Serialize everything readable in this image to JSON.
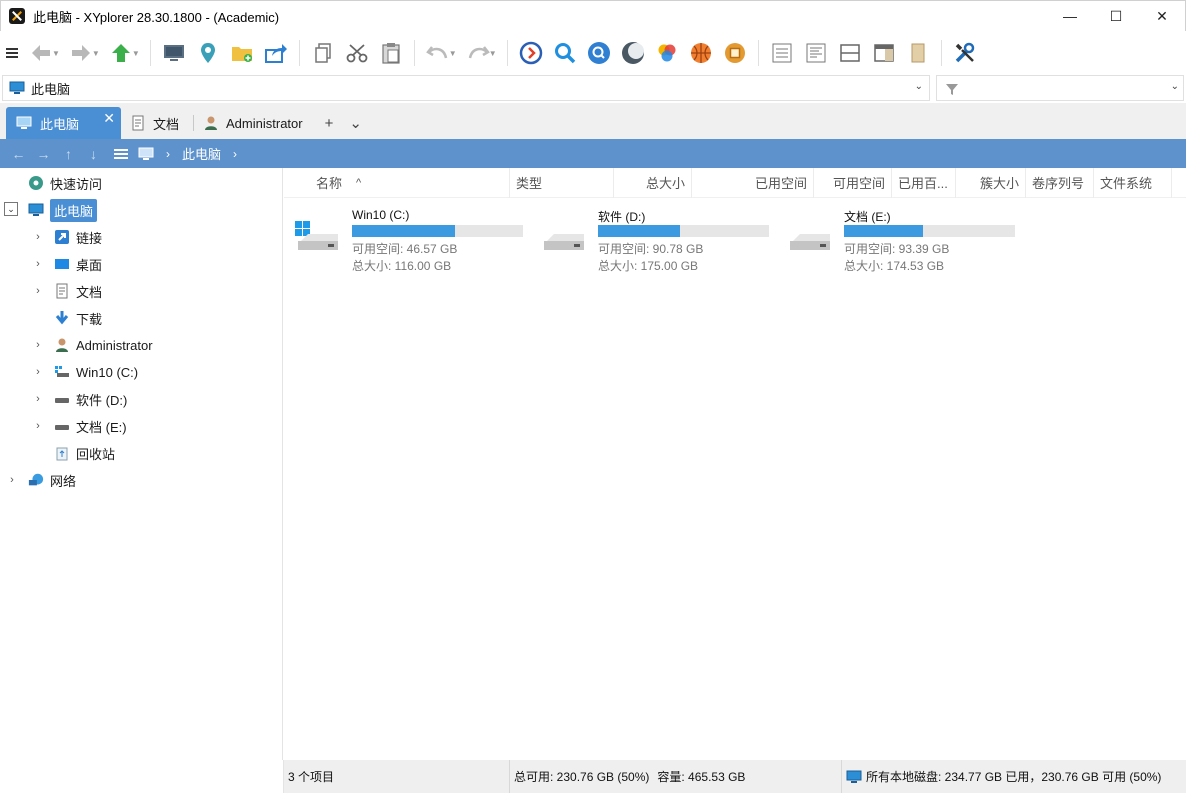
{
  "window": {
    "title": "此电脑 - XYplorer 28.30.1800 - (Academic)",
    "minimize": "—",
    "maximize": "☐",
    "close": "✕"
  },
  "address": {
    "path": "此电脑"
  },
  "tabs": [
    {
      "label": "此电脑",
      "icon": "computer-icon"
    },
    {
      "label": "文档",
      "icon": "document-icon"
    },
    {
      "label": "Administrator",
      "icon": "user-icon"
    }
  ],
  "tab_close": "✕",
  "tab_plus": "+",
  "tab_menu": "⌄",
  "breadcrumb": {
    "current": "此电脑",
    "separator": "›"
  },
  "tree": {
    "quick_access": "快速访问",
    "this_pc": "此电脑",
    "items": [
      {
        "label": "链接",
        "icon": "link-icon"
      },
      {
        "label": "桌面",
        "icon": "desktop-icon"
      },
      {
        "label": "文档",
        "icon": "document-icon"
      },
      {
        "label": "下载",
        "icon": "download-icon"
      },
      {
        "label": "Administrator",
        "icon": "user-icon"
      },
      {
        "label": "Win10 (C:)",
        "icon": "windows-drive-icon"
      },
      {
        "label": "软件 (D:)",
        "icon": "drive-icon"
      },
      {
        "label": "文档 (E:)",
        "icon": "drive-icon"
      },
      {
        "label": "回收站",
        "icon": "recycle-bin-icon"
      }
    ],
    "network": "网络"
  },
  "columns": {
    "name": "名称",
    "sort_indicator": "^",
    "type": "类型",
    "total_size": "总大小",
    "used_space": "已用空间",
    "free_space": "可用空间",
    "used_percent": "已用百...",
    "cluster_size": "簇大小",
    "serial": "卷序列号",
    "filesystem": "文件系统"
  },
  "drives": [
    {
      "name": "Win10 (C:)",
      "free": "可用空间: 46.57 GB",
      "total": "总大小: 116.00 GB",
      "used_fraction": 0.6,
      "icon": "windows-drive-icon"
    },
    {
      "name": "软件 (D:)",
      "free": "可用空间: 90.78 GB",
      "total": "总大小: 175.00 GB",
      "used_fraction": 0.48,
      "icon": "drive-icon"
    },
    {
      "name": "文档 (E:)",
      "free": "可用空间: 93.39 GB",
      "total": "总大小: 174.53 GB",
      "used_fraction": 0.46,
      "icon": "drive-icon"
    }
  ],
  "status": {
    "count": "3 个项目",
    "free_total": "总可用: 230.76 GB (50%)",
    "capacity": "容量: 465.53 GB",
    "all_disks": "所有本地磁盘: 234.77 GB 已用，230.76 GB 可用 (50%)"
  },
  "colors": {
    "accent": "#4a8ed4",
    "crumbbar": "#5d92cc",
    "drive_bar": "#3c9ae0"
  }
}
